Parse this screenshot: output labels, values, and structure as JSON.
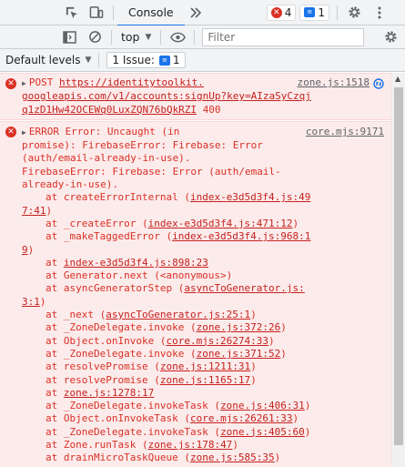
{
  "tabbar": {
    "tabs": [
      {
        "label": "Console"
      }
    ],
    "error_count": "4",
    "info_count": "1"
  },
  "toolbar2": {
    "context": "top",
    "filter_placeholder": "Filter"
  },
  "toolbar3": {
    "levels_label": "Default levels",
    "issues_label": "1 Issue:",
    "issues_count": "1"
  },
  "messages": [
    {
      "kind": "network-error",
      "method": "POST",
      "url_part1": "https://identitytoolkit.",
      "url_part2": "googleapis.com/v1/accounts:signUp?key=AIzaSyCzqj",
      "url_part3": "q1zD1Hw42OCEWq0LuxZQN76bQkRZI",
      "status": "400",
      "source": "zone.js:1518"
    },
    {
      "kind": "error",
      "source": "core.mjs:9171",
      "text_lines": [
        "ERROR Error: Uncaught (in",
        "promise): FirebaseError: Firebase: Error",
        "(auth/email-already-in-use).",
        "FirebaseError: Firebase: Error (auth/email-",
        "already-in-use)."
      ],
      "frames": [
        {
          "fn": "at createErrorInternal (",
          "loc": "index-e3d5d3f4.js:49",
          "loc2": "7:41",
          "end": ")"
        },
        {
          "fn": "at _createError (",
          "loc": "index-e3d5d3f4.js:471:12",
          "loc2": "",
          "end": ")"
        },
        {
          "fn": "at _makeTaggedError (",
          "loc": "index-e3d5d3f4.js:968:1",
          "loc2": "9",
          "end": ")"
        },
        {
          "fn": "at ",
          "loc": "index-e3d5d3f4.js:898:23",
          "loc2": "",
          "end": ""
        },
        {
          "fn": "at Generator.next (<anonymous>)",
          "loc": "",
          "loc2": "",
          "end": ""
        },
        {
          "fn": "at asyncGeneratorStep (",
          "loc": "asyncToGenerator.js:",
          "loc2": "3:1",
          "end": ")"
        },
        {
          "fn": "at _next (",
          "loc": "asyncToGenerator.js:25:1",
          "loc2": "",
          "end": ")"
        },
        {
          "fn": "at _ZoneDelegate.invoke (",
          "loc": "zone.js:372:26",
          "loc2": "",
          "end": ")"
        },
        {
          "fn": "at Object.onInvoke (",
          "loc": "core.mjs:26274:33",
          "loc2": "",
          "end": ")"
        },
        {
          "fn": "at _ZoneDelegate.invoke (",
          "loc": "zone.js:371:52",
          "loc2": "",
          "end": ")"
        },
        {
          "fn": "at resolvePromise (",
          "loc": "zone.js:1211:31",
          "loc2": "",
          "end": ")"
        },
        {
          "fn": "at resolvePromise (",
          "loc": "zone.js:1165:17",
          "loc2": "",
          "end": ")"
        },
        {
          "fn": "at ",
          "loc": "zone.js:1278:17",
          "loc2": "",
          "end": ""
        },
        {
          "fn": "at _ZoneDelegate.invokeTask (",
          "loc": "zone.js:406:31",
          "loc2": "",
          "end": ")"
        },
        {
          "fn": "at Object.onInvokeTask (",
          "loc": "core.mjs:26261:33",
          "loc2": "",
          "end": ")"
        },
        {
          "fn": "at _ZoneDelegate.invokeTask (",
          "loc": "zone.js:405:60",
          "loc2": "",
          "end": ")"
        },
        {
          "fn": "at Zone.runTask (",
          "loc": "zone.js:178:47",
          "loc2": "",
          "end": ")"
        },
        {
          "fn": "at drainMicroTaskQueue (",
          "loc": "zone.js:585:35",
          "loc2": "",
          "end": ")"
        }
      ]
    }
  ],
  "icons": {
    "inspect": "inspect-element-icon",
    "device": "device-toolbar-icon",
    "more_tabs": "double-chevron-icon",
    "settings": "gear-icon",
    "menu": "kebab-menu-icon",
    "sidebar": "sidebar-toggle-icon",
    "clear": "clear-console-icon",
    "eye": "live-expression-icon"
  },
  "colors": {
    "error_text": "#d93025",
    "error_bg": "#fcebeb",
    "accent": "#1a73e8"
  }
}
